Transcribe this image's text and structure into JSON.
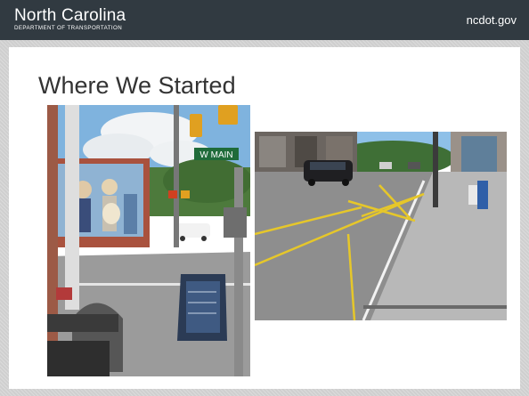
{
  "header": {
    "logo_name": "North Carolina",
    "logo_dept": "Department of Transportation",
    "domain": "ncdot.gov"
  },
  "slide": {
    "title": "Where We Started"
  },
  "photos": [
    {
      "street_sign": "W MAIN"
    },
    {}
  ],
  "colors": {
    "header_bg": "#313a41",
    "frame_bg": "#cfcfcf",
    "title_text": "#333333"
  }
}
